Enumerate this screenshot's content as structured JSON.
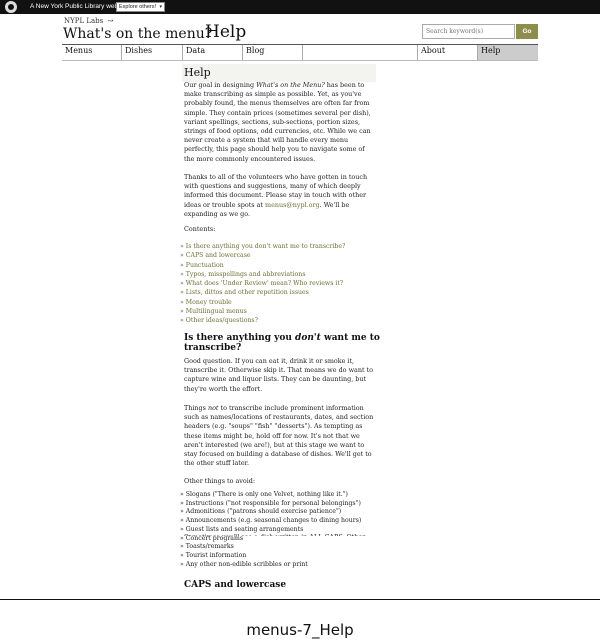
{
  "topbar": {
    "site_text": "A New York Public Library website",
    "explore_label": "Explore others!",
    "explore_caret": "▾"
  },
  "header": {
    "org": "NYPL Labs",
    "org_mark": "↝",
    "site_title": "What's on the menu?",
    "page_heading": "Help",
    "search_placeholder": "Search keyword(s)",
    "go_label": "Go"
  },
  "nav": {
    "items": [
      {
        "label": "Menus"
      },
      {
        "label": "Dishes"
      },
      {
        "label": "Data"
      },
      {
        "label": "Blog"
      },
      {
        "label": ""
      },
      {
        "label": "About"
      },
      {
        "label": "Help"
      }
    ]
  },
  "content": {
    "title": "Help",
    "intro_before": "Our goal in designing ",
    "intro_em": "What's on the Menu?",
    "intro_after": " has been to make transcribing as simple as possible. Yet, as you've probably found, the menus themselves are often far from simple. They contain prices (sometimes several per dish), variant spellings, sections, sub-sections, portion sizes, strings of food options, odd currencies, etc. While we can never create a system that will handle every menu perfectly, this page should help you to navigate some of the more commonly encountered issues.",
    "thanks_before": "Thanks to all of the volunteers who have gotten in touch with questions and suggestions, many of which deeply informed this document. Please stay in touch with other ideas or trouble spots at ",
    "thanks_link": "menus@nypl.org",
    "thanks_after": ". We'll be expanding as we go.",
    "contents_label": "Contents:",
    "toc": [
      "Is there anything you don't want me to transcribe?",
      "CAPS and lowercase",
      "Punctuation",
      "Typos, misspellings and abbreviations",
      "What does 'Under Review' mean? Who reviews it?",
      "Lists, dittos and other repetition issues",
      "Money trouble",
      "Multilingual menus",
      "Other ideas/questions?"
    ],
    "section1_before": "Is there anything you ",
    "section1_em": "don't",
    "section1_after": " want me to transcribe?",
    "section1_p1": "Good question. If you can eat it, drink it or smoke it, transcribe it. Otherwise skip it. That means we do want to capture wine and liquor lists. They can be daunting, but they're worth the effort.",
    "section1_p2_before": "Things ",
    "section1_p2_em": "not",
    "section1_p2_after": " to transcribe include prominent information such as names/locations of restaurants, dates, and section headers (e.g. \"soups\" \"fish\" \"desserts\"). As tempting as these items might be, hold off for now. It's not that we aren't interested (we are!), but at this stage we want to stay focused on building a database of dishes. We'll get to the other stuff later.",
    "avoid_label": "Other things to avoid:",
    "avoid": [
      "Slogans (\"There is only one Velvet, nothing like it.\")",
      "Instructions (\"not responsible for personal belongings\")",
      "Admonitions (\"patrons should exercise patience\")",
      "Announcements (e.g. seasonal changes to dining hours)",
      "Guest lists and seating arrangements",
      "Concert programs",
      "Toasts/remarks",
      "Tourist information",
      "Any other non-edible scribbles or print"
    ],
    "section2": "CAPS and lowercase",
    "section2_cut": "Sometimes you'll see a dish written in ALL CAPS. Other"
  },
  "caption": "menus-7_Help"
}
